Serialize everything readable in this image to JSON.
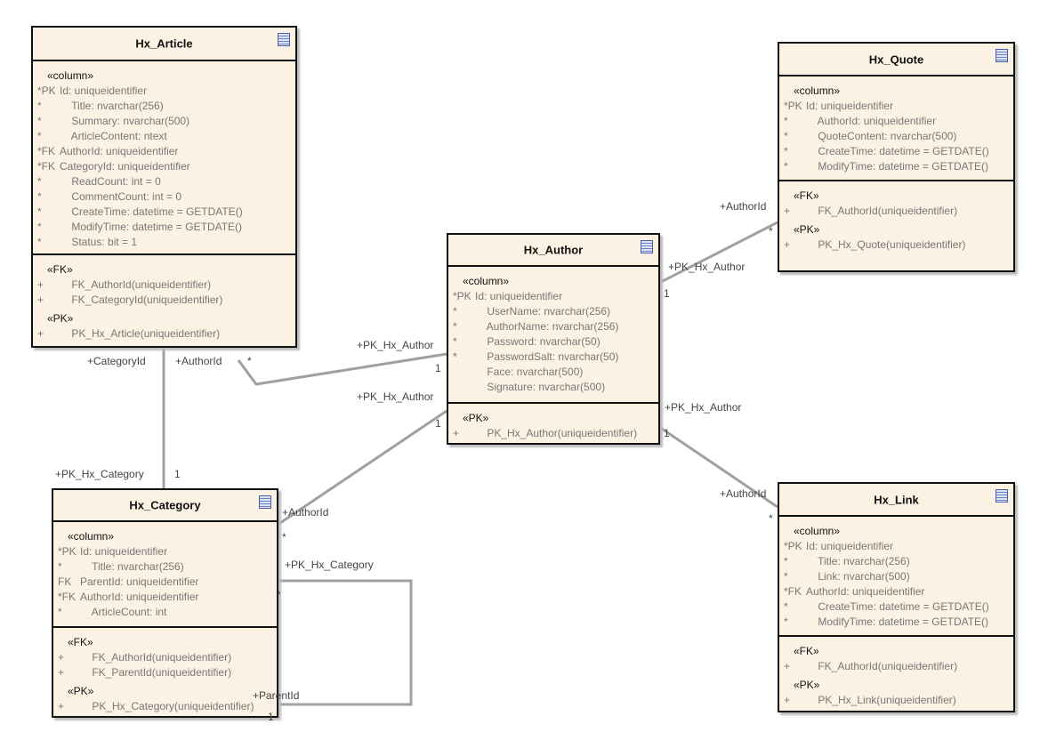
{
  "tables": [
    {
      "name": "Hx_Article",
      "icon": "table-icon",
      "sections": [
        {
          "stereotype": "«column»",
          "rows": [
            {
              "k": "*PK",
              "v": "Id: uniqueidentifier"
            },
            {
              "k": "*",
              "v": "    Title: nvarchar(256)"
            },
            {
              "k": "*",
              "v": "    Summary: nvarchar(500)"
            },
            {
              "k": "*",
              "v": "    ArticleContent: ntext"
            },
            {
              "k": "*FK",
              "v": "AuthorId: uniqueidentifier"
            },
            {
              "k": "*FK",
              "v": "CategoryId: uniqueidentifier"
            },
            {
              "k": "*",
              "v": "    ReadCount: int = 0"
            },
            {
              "k": "*",
              "v": "    CommentCount: int = 0"
            },
            {
              "k": "*",
              "v": "    CreateTime: datetime = GETDATE()"
            },
            {
              "k": "*",
              "v": "    ModifyTime: datetime = GETDATE()"
            },
            {
              "k": "*",
              "v": "    Status: bit = 1"
            }
          ]
        },
        {
          "groups": [
            {
              "stereotype": "«FK»",
              "rows": [
                {
                  "k": "+",
                  "v": "    FK_AuthorId(uniqueidentifier)"
                },
                {
                  "k": "+",
                  "v": "    FK_CategoryId(uniqueidentifier)"
                }
              ]
            },
            {
              "stereotype": "«PK»",
              "rows": [
                {
                  "k": "+",
                  "v": "    PK_Hx_Article(uniqueidentifier)"
                }
              ]
            }
          ]
        }
      ]
    },
    {
      "name": "Hx_Quote",
      "icon": "table-icon",
      "sections": [
        {
          "stereotype": "«column»",
          "rows": [
            {
              "k": "*PK",
              "v": "Id: uniqueidentifier"
            },
            {
              "k": "*",
              "v": "    AuthorId: uniqueidentifier"
            },
            {
              "k": "*",
              "v": "    QuoteContent: nvarchar(500)"
            },
            {
              "k": "*",
              "v": "    CreateTime: datetime = GETDATE()"
            },
            {
              "k": "*",
              "v": "    ModifyTime: datetime = GETDATE()"
            }
          ]
        },
        {
          "groups": [
            {
              "stereotype": "«FK»",
              "rows": [
                {
                  "k": "+",
                  "v": "    FK_AuthorId(uniqueidentifier)"
                }
              ]
            },
            {
              "stereotype": "«PK»",
              "rows": [
                {
                  "k": "+",
                  "v": "    PK_Hx_Quote(uniqueidentifier)"
                }
              ]
            }
          ]
        }
      ]
    },
    {
      "name": "Hx_Author",
      "icon": "table-icon",
      "sections": [
        {
          "stereotype": "«column»",
          "rows": [
            {
              "k": "*PK",
              "v": "Id: uniqueidentifier"
            },
            {
              "k": "*",
              "v": "    UserName: nvarchar(256)"
            },
            {
              "k": "*",
              "v": "    AuthorName: nvarchar(256)"
            },
            {
              "k": "*",
              "v": "    Password: nvarchar(50)"
            },
            {
              "k": "*",
              "v": "    PasswordSalt: nvarchar(50)"
            },
            {
              "k": "",
              "v": "    Face: nvarchar(500)"
            },
            {
              "k": "",
              "v": "    Signature: nvarchar(500)"
            }
          ]
        },
        {
          "groups": [
            {
              "stereotype": "«PK»",
              "rows": [
                {
                  "k": "+",
                  "v": "    PK_Hx_Author(uniqueidentifier)"
                }
              ]
            }
          ]
        }
      ]
    },
    {
      "name": "Hx_Category",
      "icon": "table-icon",
      "sections": [
        {
          "stereotype": "«column»",
          "rows": [
            {
              "k": "*PK",
              "v": "Id: uniqueidentifier"
            },
            {
              "k": "*",
              "v": "    Title: nvarchar(256)"
            },
            {
              "k": "FK",
              "v": "ParentId: uniqueidentifier"
            },
            {
              "k": "*FK",
              "v": "AuthorId: uniqueidentifier"
            },
            {
              "k": "*",
              "v": "    ArticleCount: int"
            }
          ]
        },
        {
          "groups": [
            {
              "stereotype": "«FK»",
              "rows": [
                {
                  "k": "+",
                  "v": "    FK_AuthorId(uniqueidentifier)"
                },
                {
                  "k": "+",
                  "v": "    FK_ParentId(uniqueidentifier)"
                }
              ]
            },
            {
              "stereotype": "«PK»",
              "rows": [
                {
                  "k": "+",
                  "v": "    PK_Hx_Category(uniqueidentifier)"
                }
              ]
            }
          ]
        }
      ]
    },
    {
      "name": "Hx_Link",
      "icon": "table-icon",
      "sections": [
        {
          "stereotype": "«column»",
          "rows": [
            {
              "k": "*PK",
              "v": "Id: uniqueidentifier"
            },
            {
              "k": "*",
              "v": "    Title: nvarchar(256)"
            },
            {
              "k": "*",
              "v": "    Link: nvarchar(500)"
            },
            {
              "k": "*FK",
              "v": "AuthorId: uniqueidentifier"
            },
            {
              "k": "*",
              "v": "    CreateTime: datetime = GETDATE()"
            },
            {
              "k": "*",
              "v": "    ModifyTime: datetime = GETDATE()"
            }
          ]
        },
        {
          "groups": [
            {
              "stereotype": "«FK»",
              "rows": [
                {
                  "k": "+",
                  "v": "    FK_AuthorId(uniqueidentifier)"
                }
              ]
            },
            {
              "stereotype": "«PK»",
              "rows": [
                {
                  "k": "+",
                  "v": "    PK_Hx_Link(uniqueidentifier)"
                }
              ]
            }
          ]
        }
      ]
    }
  ],
  "connector_labels": [
    "+CategoryId",
    "+AuthorId",
    "*",
    "+PK_Hx_Author",
    "1",
    "+PK_Hx_Author",
    "1",
    "+PK_Hx_Category",
    "1",
    "+AuthorId",
    "*",
    "+PK_Hx_Category",
    "*",
    "+ParentId",
    "1",
    "+AuthorId",
    "*",
    "+PK_Hx_Author",
    "1",
    "+PK_Hx_Author",
    "1",
    "+AuthorId",
    "*"
  ],
  "colors": {
    "table_fill": "#fcf2e3",
    "border": "#111111",
    "line": "#a0a0a0",
    "column_text": "#777777"
  }
}
